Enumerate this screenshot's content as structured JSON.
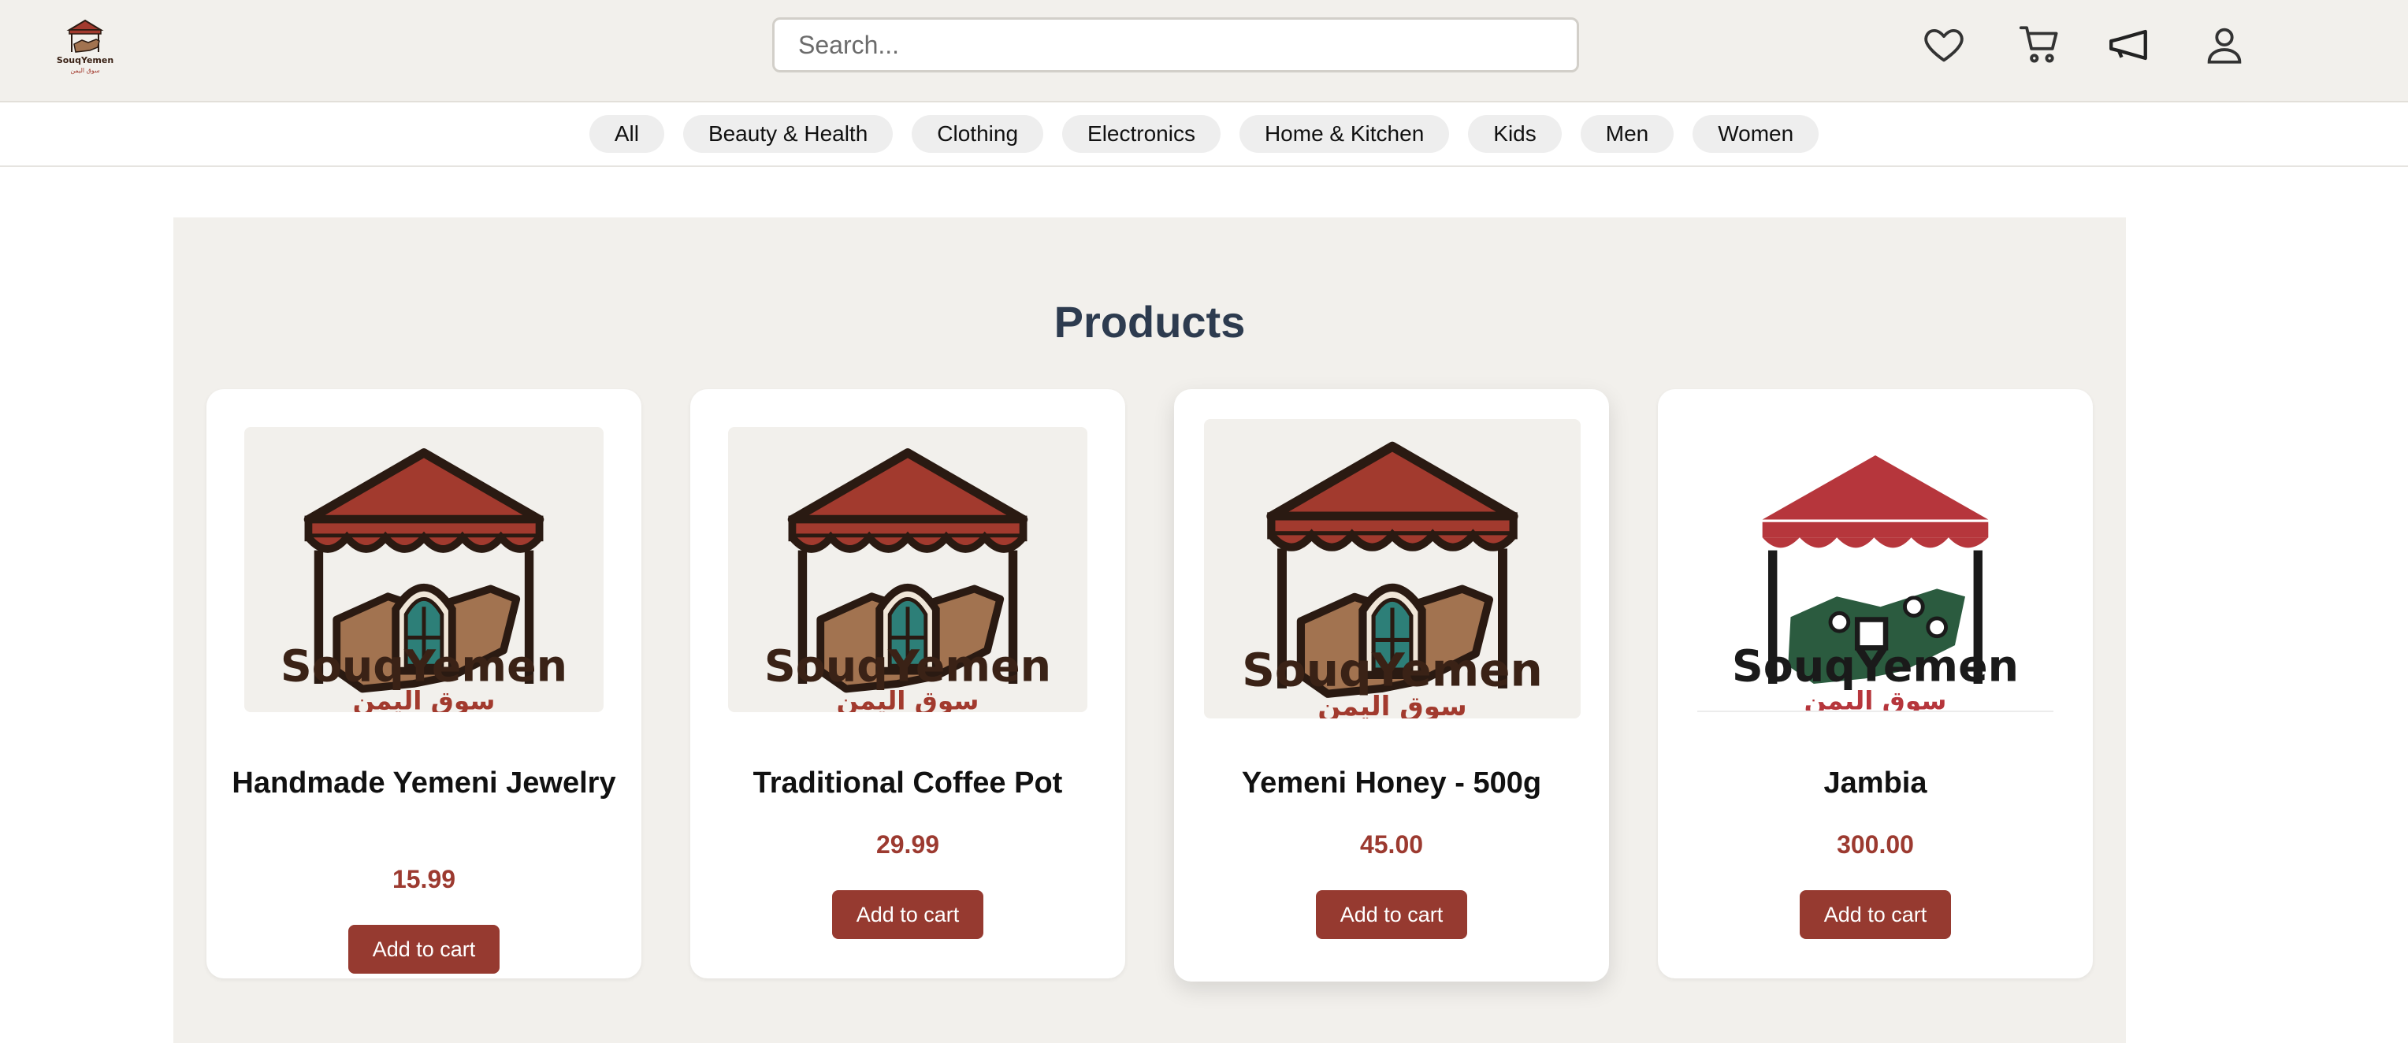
{
  "header": {
    "logo_text": "SouqYemen",
    "logo_text_ar": "سوق اليمن",
    "search": {
      "placeholder": "Search...",
      "value": ""
    },
    "icons": [
      "heart-icon",
      "cart-icon",
      "megaphone-icon",
      "user-icon"
    ]
  },
  "categories": [
    "All",
    "Beauty & Health",
    "Clothing",
    "Electronics",
    "Home & Kitchen",
    "Kids",
    "Men",
    "Women"
  ],
  "products_section": {
    "title": "Products",
    "add_label": "Add to cart",
    "items": [
      {
        "name": "Handmade Yemeni Jewelry",
        "price": "15.99",
        "logo_en": "SouqYemen",
        "logo_ar": "سوق اليمن"
      },
      {
        "name": "Traditional Coffee Pot",
        "price": "29.99",
        "logo_en": "SouqYemen",
        "logo_ar": "سوق اليمن"
      },
      {
        "name": "Yemeni Honey - 500g",
        "price": "45.00",
        "logo_en": "SouqYemen",
        "logo_ar": "سوق اليمن"
      },
      {
        "name": "Jambia",
        "price": "300.00",
        "logo_en": "SouqYemen",
        "logo_ar": "سوق اليمن"
      }
    ]
  },
  "colors": {
    "brand_red": "#963a30",
    "price_red": "#9c3a30",
    "title_navy": "#2d3b4f",
    "header_bg": "#f2f0ec",
    "logo_brown": "#3a2216",
    "map_green": "#2b5b3f"
  }
}
